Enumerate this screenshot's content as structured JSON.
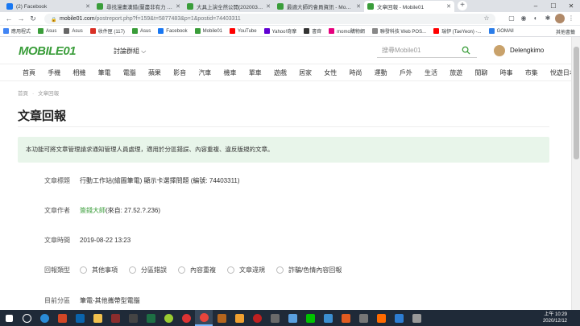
{
  "browser": {
    "tabs": [
      {
        "title": "(2) Facebook",
        "favicon_color": "#1877f2",
        "active": false
      },
      {
        "title": "尋找漫畫漢錯(蘭盡非有力 - 微供",
        "favicon_color": "#3a9d3a",
        "active": false
      },
      {
        "title": "大具上演全然公開(202003 play...",
        "favicon_color": "#3a9d3a",
        "active": false
      },
      {
        "title": "最適大師的會員資訊 - Mobile01",
        "favicon_color": "#3a9d3a",
        "active": false
      },
      {
        "title": "文章回報 - Mobile01",
        "favicon_color": "#3a9d3a",
        "active": true
      }
    ],
    "new_tab": "+",
    "url_host": "mobile01.com",
    "url_path": "/postreport.php?f=159&t=5877483&p=1&postid=74403311"
  },
  "bookmarks": [
    {
      "label": "應用程式",
      "color": "#4285f4"
    },
    {
      "label": "Asus",
      "color": "#3a9d3a"
    },
    {
      "label": "Asus",
      "color": "#666"
    },
    {
      "label": "收件匣 (117)",
      "color": "#d93025"
    },
    {
      "label": "Asus",
      "color": "#3a9d3a"
    },
    {
      "label": "Facebook",
      "color": "#1877f2"
    },
    {
      "label": "Mobile01",
      "color": "#3a9d3a"
    },
    {
      "label": "YouTube",
      "color": "#ff0000"
    },
    {
      "label": "Yahoo!奇摩",
      "color": "#6001d2"
    },
    {
      "label": "書齊",
      "color": "#333"
    },
    {
      "label": "momo購物網",
      "color": "#e6007e"
    },
    {
      "label": "聯發科技 Web POS...",
      "color": "#888"
    },
    {
      "label": "瑞伊 (TaeYeon) -...",
      "color": "#ff0000"
    },
    {
      "label": "GOMAll",
      "color": "#2b7de9"
    }
  ],
  "bookmarks_other": "其他書籤",
  "site": {
    "logo": "MOBILE01",
    "forum_group": "討論群組",
    "search_placeholder": "搜尋Mobile01",
    "username": "Delengkimo",
    "categories": [
      "首頁",
      "手機",
      "相機",
      "筆電",
      "電腦",
      "蘋果",
      "影音",
      "汽車",
      "機車",
      "單車",
      "遊戲",
      "居家",
      "女性",
      "時尚",
      "運動",
      "戶外",
      "生活",
      "旅遊",
      "閒聊",
      "時事",
      "市集",
      "悅遊日本"
    ],
    "breadcrumb": [
      "首頁",
      "文章回報"
    ],
    "page_title": "文章回報",
    "notice": "本功能可將文章管理請求通知管理人員處理，適用於分區錯誤、內容重複、違反版規的文章。",
    "form": {
      "title_label": "文章標題",
      "title_value": "行動工作站(繪圖筆電) 顯示卡選擇問題 (編號: 74403311)",
      "author_label": "文章作者",
      "author_name": "簽錢大師",
      "author_ip": " (來自: 27.52.?.236)",
      "time_label": "文章時間",
      "time_value": "2019-08-22 13:23",
      "type_label": "回報類型",
      "type_options": [
        "其他事項",
        "分區錯誤",
        "內容重複",
        "文章違規",
        "詐騙/色情內容回報"
      ],
      "category_label": "目前分區",
      "category_value": "筆電-其他攜帶型電腦"
    }
  },
  "taskbar": {
    "time": "上午 10:29",
    "date": "2020/12/12"
  }
}
